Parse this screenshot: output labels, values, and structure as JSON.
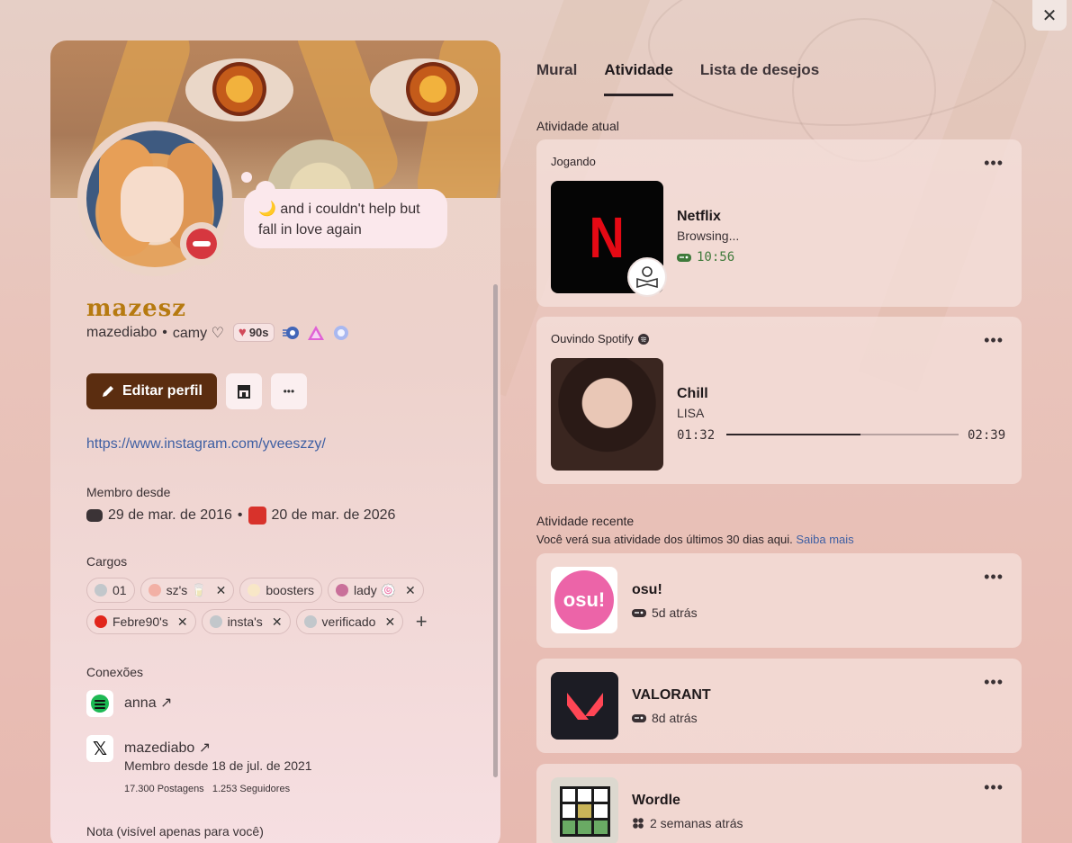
{
  "close_label": "✕",
  "profile": {
    "bubble_emoji": "🌙",
    "bubble_text": "and i couldn't help but fall in love again",
    "display_name": "mazesz",
    "username": "mazediabo",
    "pronouns": "camy ♡",
    "tag_label": "90s",
    "edit_button": "Editar perfil",
    "link": "https://www.instagram.com/yveeszzy/",
    "member_since_title": "Membro desde",
    "member_since_discord": "29 de mar. de 2016",
    "member_since_server": "20 de mar. de 2026",
    "roles_title": "Cargos",
    "roles": [
      {
        "name": "01",
        "color": "#c2c7cb",
        "removable": false
      },
      {
        "name": "sz's 🥛",
        "color": "#f2b0a5",
        "removable": true
      },
      {
        "name": "boosters",
        "color": "#f8e7c7",
        "removable": false
      },
      {
        "name": "lady 🍥",
        "color": "#c9709a",
        "removable": true
      },
      {
        "name": "Febre90's",
        "color": "#e1261c",
        "removable": true
      },
      {
        "name": "insta's",
        "color": "#c2c7cb",
        "removable": true
      },
      {
        "name": "verificado",
        "color": "#c2c7cb",
        "removable": true
      }
    ],
    "connections_title": "Conexões",
    "connections": {
      "spotify_name": "anna",
      "x_name": "mazediabo",
      "x_member_since": "Membro desde 18 de jul. de 2021",
      "x_stats": "17.300 Postagens   1.253 Seguidores"
    },
    "note_title": "Nota (visível apenas para você)"
  },
  "tabs": {
    "mural": "Mural",
    "atividade": "Atividade",
    "desejos": "Lista de desejos"
  },
  "current": {
    "title": "Atividade atual",
    "playing": {
      "header": "Jogando",
      "name": "Netflix",
      "state": "Browsing...",
      "time": "10:56"
    },
    "spotify": {
      "header": "Ouvindo Spotify",
      "track": "Chill",
      "artist": "LISA",
      "elapsed": "01:32",
      "total": "02:39",
      "progress": 0.579
    }
  },
  "recent": {
    "title": "Atividade recente",
    "subtitle": "Você verá sua atividade dos últimos 30 dias aqui.",
    "learn_more": "Saiba mais",
    "items": [
      {
        "name": "osu!",
        "time": "5d atrás",
        "thumb_text": "osu!"
      },
      {
        "name": "VALORANT",
        "time": "8d atrás"
      },
      {
        "name": "Wordle",
        "time": "2 semanas atrás"
      }
    ]
  },
  "dots": "•••",
  "colors": {
    "accent_button": "#5b2d10",
    "link": "#3e5fa3",
    "dnd": "#d6373f",
    "timer_green": "#3f7a3b"
  }
}
